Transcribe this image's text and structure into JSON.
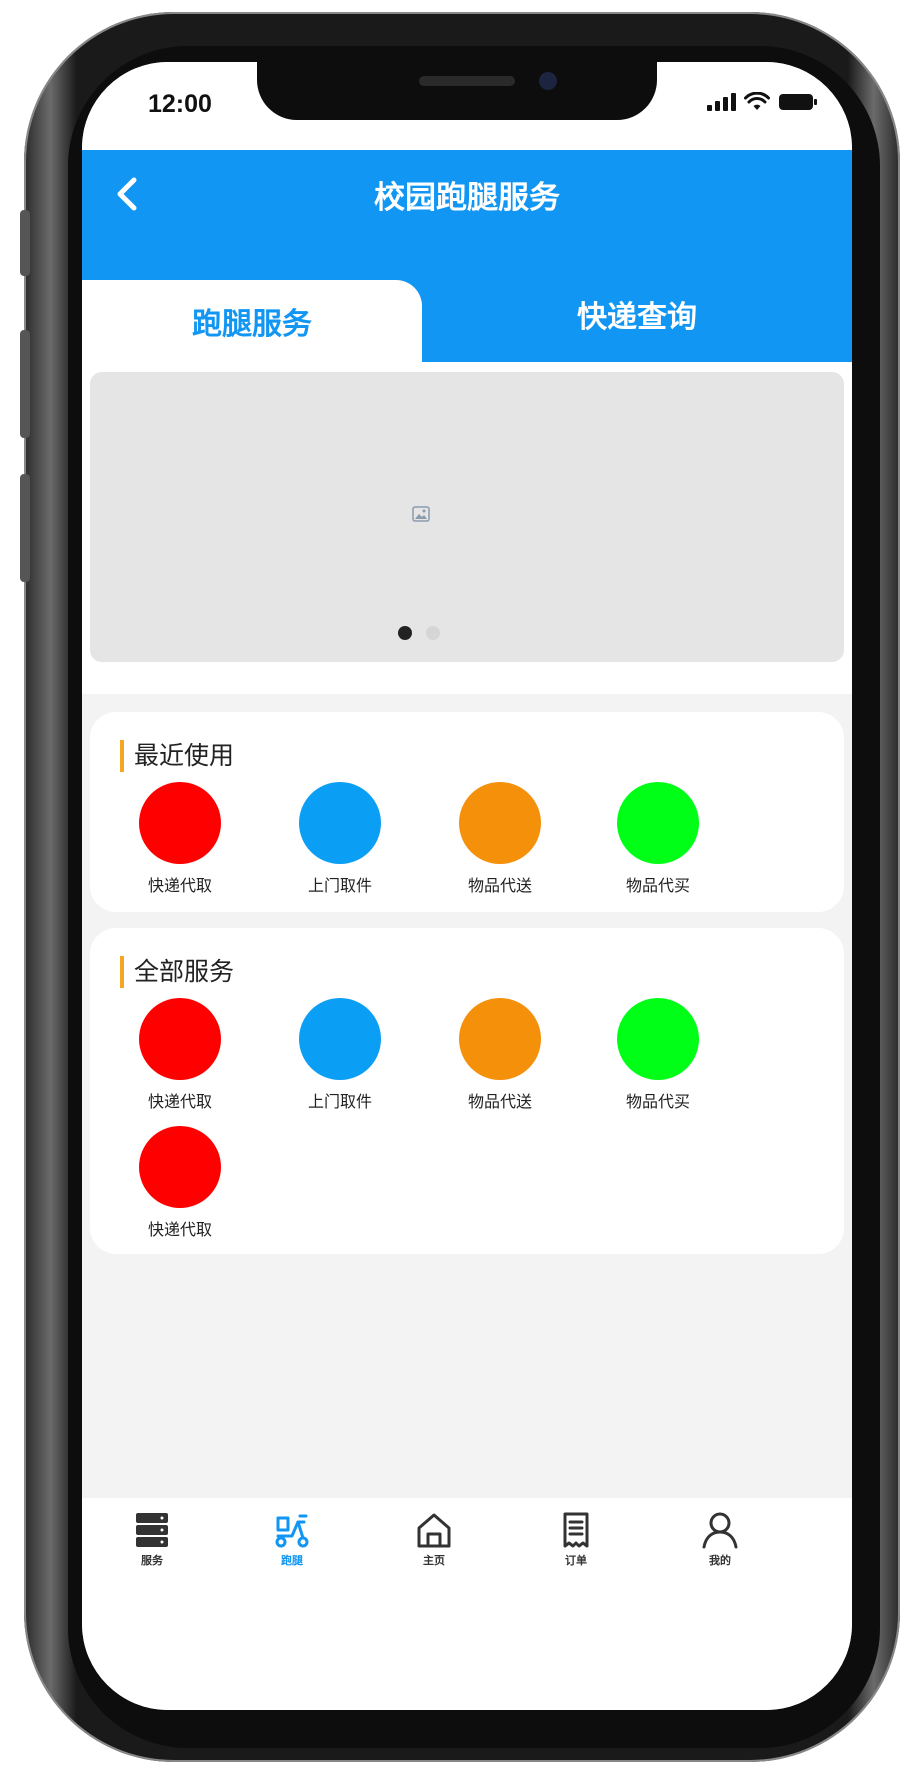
{
  "status_bar": {
    "time": "12:00"
  },
  "header": {
    "title": "校园跑腿服务"
  },
  "tabs": [
    {
      "label": "跑腿服务",
      "active": true
    },
    {
      "label": "快递查询",
      "active": false
    }
  ],
  "banner": {
    "active_index": 0,
    "dot_count": 2
  },
  "sections": [
    {
      "title": "最近使用",
      "items": [
        {
          "label": "快递代取",
          "color": "#ff0000"
        },
        {
          "label": "上门取件",
          "color": "#0b9ef5"
        },
        {
          "label": "物品代送",
          "color": "#f5900a"
        },
        {
          "label": "物品代买",
          "color": "#00ff17"
        }
      ]
    },
    {
      "title": "全部服务",
      "items": [
        {
          "label": "快递代取",
          "color": "#ff0000"
        },
        {
          "label": "上门取件",
          "color": "#0b9ef5"
        },
        {
          "label": "物品代送",
          "color": "#f5900a"
        },
        {
          "label": "物品代买",
          "color": "#00ff17"
        },
        {
          "label": "快递代取",
          "color": "#ff0000"
        }
      ]
    }
  ],
  "tab_bar": [
    {
      "label": "服务",
      "icon": "server-icon",
      "active": false
    },
    {
      "label": "跑腿",
      "icon": "scooter-icon",
      "active": true
    },
    {
      "label": "主页",
      "icon": "home-icon",
      "active": false
    },
    {
      "label": "订单",
      "icon": "receipt-icon",
      "active": false
    },
    {
      "label": "我的",
      "icon": "user-icon",
      "active": false
    }
  ],
  "colors": {
    "primary": "#1296f3",
    "accent": "#f5a623",
    "background": "#f3f3f3"
  }
}
